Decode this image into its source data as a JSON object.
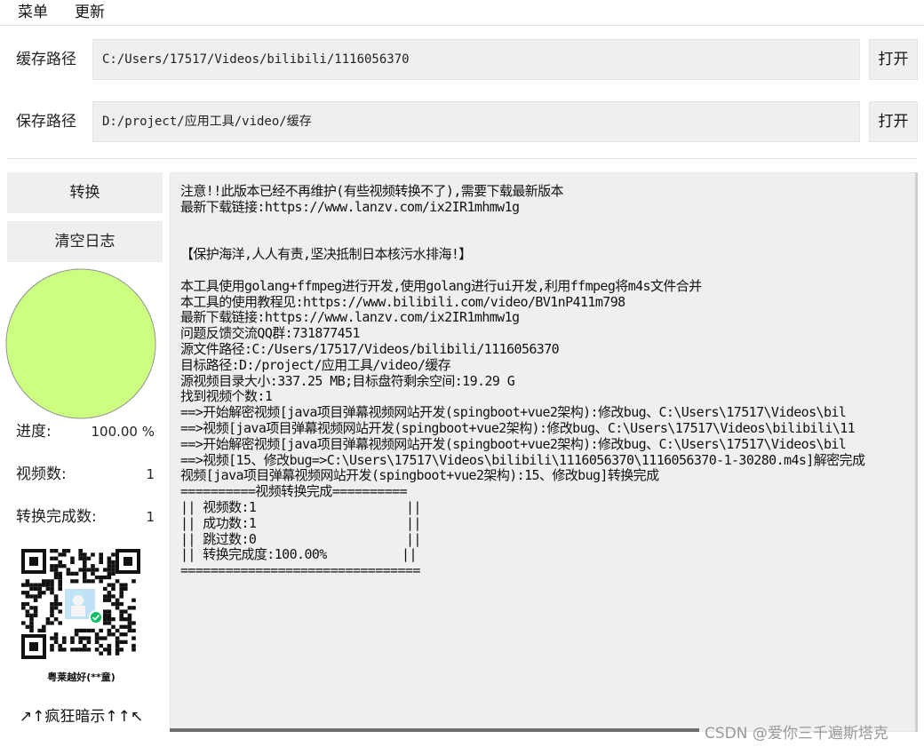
{
  "menubar": {
    "items": [
      "菜单",
      "更新"
    ]
  },
  "paths": {
    "cache": {
      "label": "缓存路径",
      "value": "C:/Users/17517/Videos/bilibili/1116056370",
      "button": "打开"
    },
    "save": {
      "label": "保存路径",
      "value": "D:/project/应用工具/video/缓存",
      "button": "打开"
    }
  },
  "sidebar": {
    "convert_button": "转换",
    "clear_log_button": "清空日志",
    "progress": {
      "label": "进度:",
      "value": "100.00 %",
      "fraction": 1.0,
      "fill_color": "#ccff80"
    },
    "video_count": {
      "label": "视频数:",
      "value": "1"
    },
    "done_count": {
      "label": "转换完成数:",
      "value": "1"
    },
    "qr": {
      "caption": "粤莱越好(**童)",
      "hint": "↗↑疯狂暗示↑↑↖"
    }
  },
  "log": {
    "lines": [
      "注意!!此版本已经不再维护(有些视频转换不了),需要下载最新版本",
      "最新下载链接:https://www.lanzv.com/ix2IR1mhmw1g",
      "",
      "",
      "【保护海洋,人人有责,坚决抵制日本核污水排海!】",
      "",
      "本工具使用golang+ffmpeg进行开发,使用golang进行ui开发,利用ffmpeg将m4s文件合并",
      "本工具的使用教程见:https://www.bilibili.com/video/BV1nP411m798",
      "最新下载链接:https://www.lanzv.com/ix2IR1mhmw1g",
      "问题反馈交流QQ群:731877451",
      "源文件路径:C:/Users/17517/Videos/bilibili/1116056370",
      "目标路径:D:/project/应用工具/video/缓存",
      "源视频目录大小:337.25 MB;目标盘符剩余空间:19.29 G",
      "找到视频个数:1",
      "==>开始解密视频[java项目弹幕视频网站开发(spingboot+vue2架构):修改bug、C:\\Users\\17517\\Videos\\bil",
      "==>视频[java项目弹幕视频网站开发(spingboot+vue2架构):修改bug、C:\\Users\\17517\\Videos\\bilibili\\11",
      "==>开始解密视频[java项目弹幕视频网站开发(spingboot+vue2架构):修改bug、C:\\Users\\17517\\Videos\\bil",
      "==>视频[15、修改bug=>C:\\Users\\17517\\Videos\\bilibili\\1116056370\\1116056370-1-30280.m4s]解密完成",
      "视频[java项目弹幕视频网站开发(spingboot+vue2架构):15、修改bug]转换完成",
      "==========视频转换完成==========",
      "|| 视频数:1                    ||",
      "|| 成功数:1                    ||",
      "|| 跳过数:0                    ||",
      "|| 转换完成度:100.00%          ||",
      "================================"
    ]
  },
  "watermark": "CSDN @爱你三千遍斯塔克"
}
